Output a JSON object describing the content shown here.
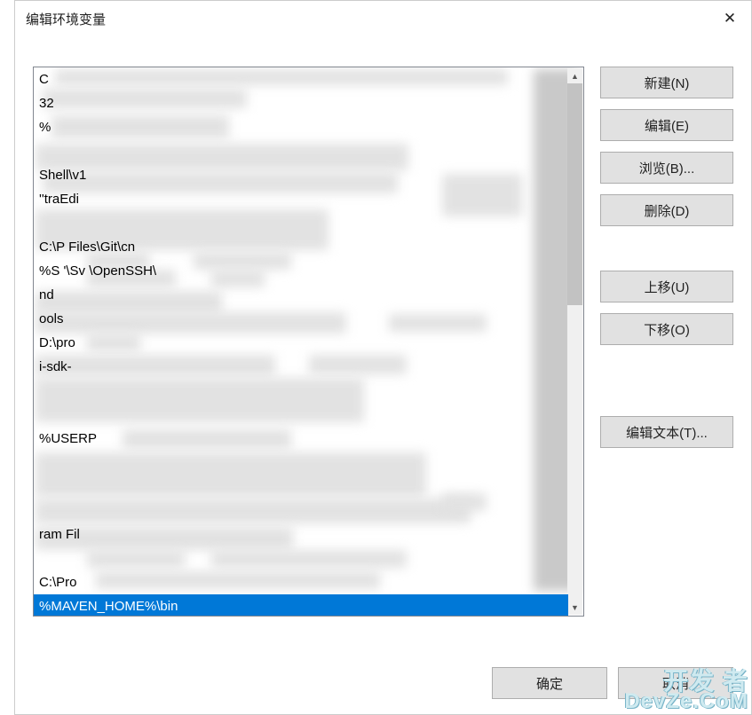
{
  "dialog": {
    "title": "编辑环境变量"
  },
  "list": {
    "rows": [
      "C",
      "32",
      "%",
      "",
      "Shell\\v1",
      "''traEdi",
      "",
      "C:\\P         Files\\Git\\cn",
      "%S                   '\\Sv         \\OpenSSH\\",
      "nd",
      "ools",
      "D:\\pro",
      "i-sdk-",
      "",
      "",
      "%USERP",
      "",
      "",
      "",
      "ram Fil",
      "",
      "C:\\Pro",
      "%MAVEN_HOME%\\bin"
    ],
    "selected_index": 22
  },
  "buttons": {
    "new": "新建(N)",
    "edit": "编辑(E)",
    "browse": "浏览(B)...",
    "delete": "删除(D)",
    "move_up": "上移(U)",
    "move_down": "下移(O)",
    "edit_text": "编辑文本(T)..."
  },
  "footer": {
    "ok": "确定",
    "cancel": "取消"
  },
  "watermark": {
    "line1": "开发 者",
    "line2": "DevZe.CoM"
  }
}
